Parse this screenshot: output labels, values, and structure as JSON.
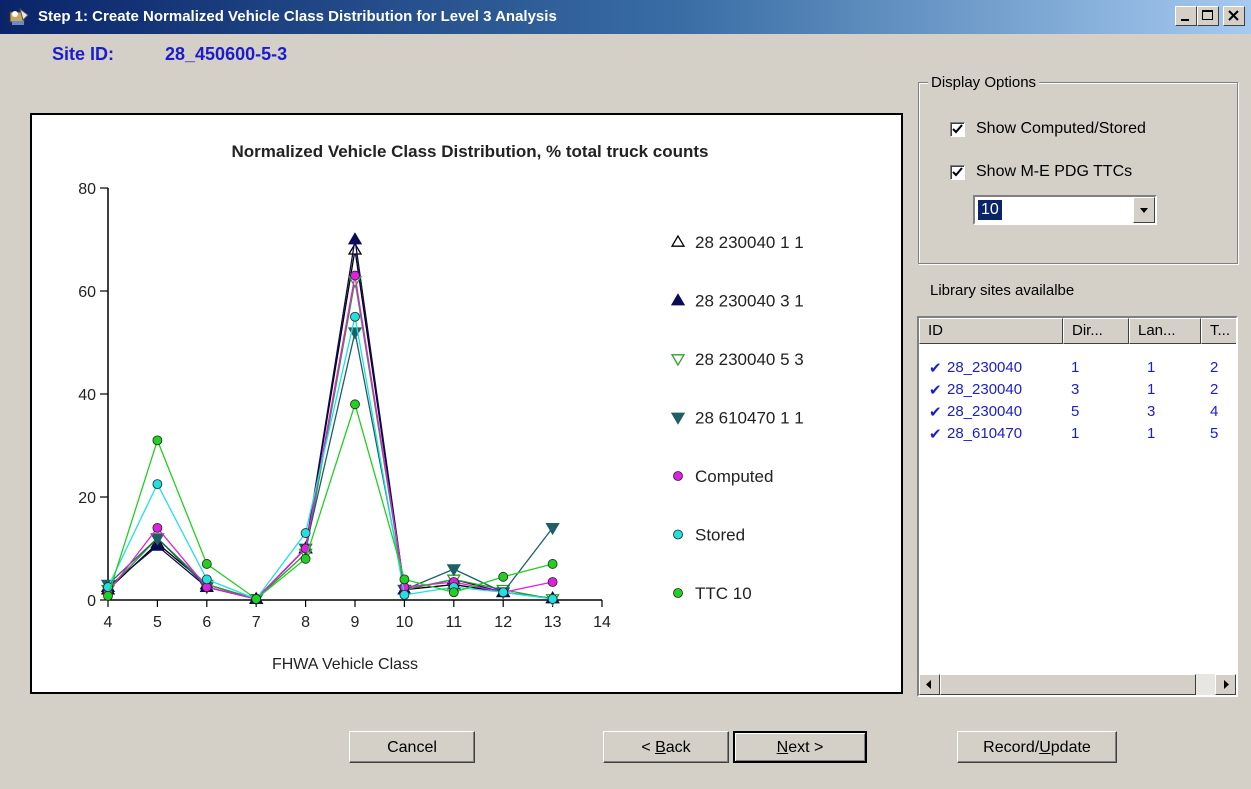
{
  "window": {
    "title": "Step 1: Create Normalized Vehicle Class Distribution for Level 3 Analysis"
  },
  "site": {
    "label": "Site ID:",
    "value": "28_450600-5-3"
  },
  "display_options": {
    "group_label": "Display Options",
    "show_computed_label": "Show Computed/Stored",
    "show_computed_checked": true,
    "show_ttc_label": "Show M-E PDG TTCs",
    "show_ttc_checked": true,
    "ttc_selected": "10"
  },
  "library": {
    "label": "Library sites availalbe",
    "columns": [
      "ID",
      "Dir...",
      "Lan...",
      "T..."
    ],
    "rows": [
      {
        "id": "28_230040",
        "dir": "1",
        "lane": "1",
        "t": "2",
        "checked": true
      },
      {
        "id": "28_230040",
        "dir": "3",
        "lane": "1",
        "t": "2",
        "checked": true
      },
      {
        "id": "28_230040",
        "dir": "5",
        "lane": "3",
        "t": "4",
        "checked": true
      },
      {
        "id": "28_610470",
        "dir": "1",
        "lane": "1",
        "t": "5",
        "checked": true
      }
    ]
  },
  "buttons": {
    "cancel": "Cancel",
    "back_prefix": "< ",
    "back_key": "B",
    "back_rest": "ack",
    "next_key": "N",
    "next_rest": "ext >",
    "record_prefix": "Record/",
    "record_key": "U",
    "record_rest": "pdate"
  },
  "chart_data": {
    "type": "line",
    "title": "Normalized Vehicle Class Distribution, % total truck counts",
    "xlabel": "FHWA Vehicle Class",
    "ylabel": "",
    "xlim": [
      4,
      14
    ],
    "ylim": [
      0,
      80
    ],
    "xticks": [
      4,
      5,
      6,
      7,
      8,
      9,
      10,
      11,
      12,
      13,
      14
    ],
    "yticks": [
      0,
      20,
      40,
      60,
      80
    ],
    "x": [
      4,
      5,
      6,
      7,
      8,
      9,
      10,
      11,
      12,
      13
    ],
    "legend_position": "right",
    "series": [
      {
        "name": "28 230040 1 1",
        "color": "#000000",
        "marker": "triangle-up-open",
        "values": [
          2,
          11,
          3,
          0.2,
          10,
          68,
          2,
          3,
          1.5,
          0.3
        ]
      },
      {
        "name": "28 230040 3 1",
        "color": "#0a0a5a",
        "marker": "triangle-up",
        "values": [
          2.5,
          10.5,
          2.5,
          0.2,
          10,
          70,
          2,
          4,
          1.5,
          0.3
        ]
      },
      {
        "name": "28 230040 5 3",
        "color": "#2ca02c",
        "marker": "triangle-down-open",
        "values": [
          2,
          12,
          3,
          0.2,
          9,
          62,
          2,
          4,
          2,
          0.2
        ]
      },
      {
        "name": "28 610470 1 1",
        "color": "#1f5f66",
        "marker": "triangle-down",
        "values": [
          3,
          12,
          2.5,
          0.2,
          10,
          52,
          2,
          6,
          1.5,
          14
        ]
      },
      {
        "name": "Computed",
        "color": "#e020e0",
        "marker": "circle",
        "values": [
          1.5,
          14,
          2.5,
          0.2,
          10,
          63,
          2.5,
          3.5,
          1.5,
          3.5
        ]
      },
      {
        "name": "Stored",
        "color": "#22e0e0",
        "marker": "circle",
        "values": [
          2.5,
          22.5,
          4,
          0.2,
          13,
          55,
          1,
          2.5,
          1.5,
          0.2
        ]
      },
      {
        "name": "TTC 10",
        "color": "#22d022",
        "marker": "circle",
        "values": [
          0.8,
          31,
          7,
          0.2,
          8,
          38,
          4,
          1.5,
          4.5,
          7
        ]
      }
    ]
  }
}
